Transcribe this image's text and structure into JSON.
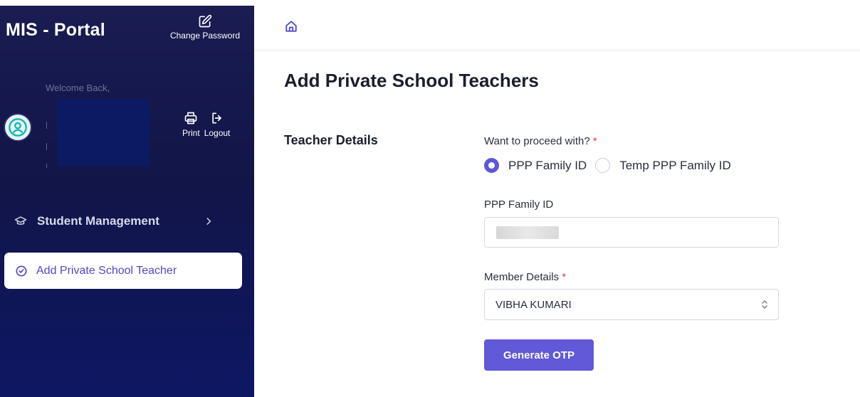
{
  "sidebar": {
    "brand": "MIS - Portal",
    "change_password_label": "Change Password",
    "welcome_text": "Welcome Back,",
    "print_label": "Print",
    "logout_label": "Logout",
    "menu": {
      "student_management_label": "Student Management",
      "active_item_label": "Add Private School Teacher"
    }
  },
  "main": {
    "page_title": "Add Private School Teachers",
    "section_title": "Teacher Details",
    "proceed_label": "Want to proceed with?",
    "required_mark": "*",
    "radio_options": [
      "PPP Family ID",
      "Temp PPP Family ID"
    ],
    "selected_option": "PPP Family ID",
    "ppp_label": "PPP Family ID",
    "member_label": "Member Details",
    "member_value": "VIBHA KUMARI",
    "generate_otp_label": "Generate OTP"
  },
  "colors": {
    "sidebar_bg": "#121548",
    "accent": "#6159d8",
    "active_text": "#5047c8",
    "required": "#e03a3a"
  },
  "icons": [
    "edit-icon",
    "user-avatar-icon",
    "print-icon",
    "logout-icon",
    "graduation-cap-icon",
    "chevron-right-icon",
    "check-circle-icon",
    "home-icon",
    "select-caret-icon"
  ]
}
